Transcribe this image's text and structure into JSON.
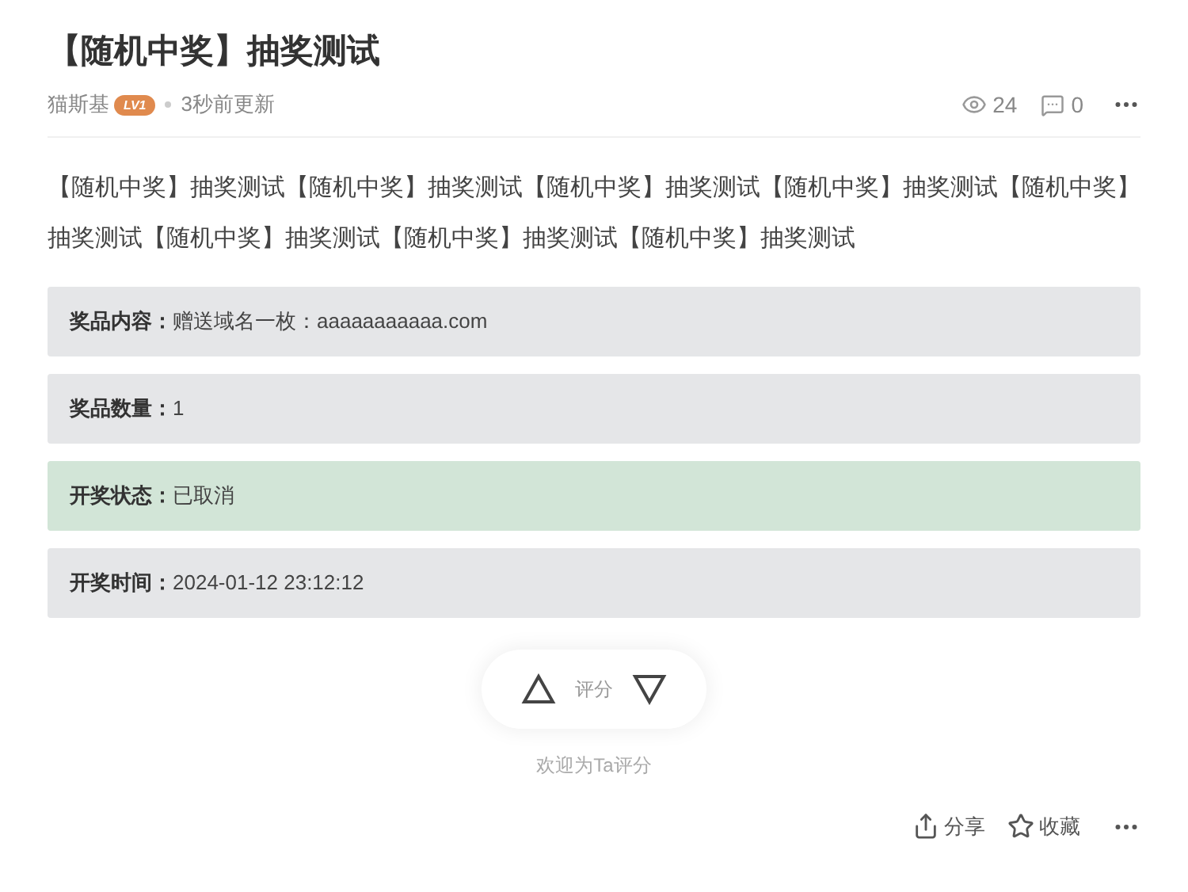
{
  "title": "【随机中奖】抽奖测试",
  "meta": {
    "author": "猫斯基",
    "level_badge": "LV1",
    "updated": "3秒前更新",
    "views": "24",
    "comments": "0"
  },
  "body": "【随机中奖】抽奖测试【随机中奖】抽奖测试【随机中奖】抽奖测试【随机中奖】抽奖测试【随机中奖】抽奖测试【随机中奖】抽奖测试【随机中奖】抽奖测试【随机中奖】抽奖测试",
  "info_rows": [
    {
      "label": "奖品内容：",
      "value": "赠送域名一枚：aaaaaaaaaaa.com",
      "color": "#e5e6e8"
    },
    {
      "label": "奖品数量：",
      "value": "1",
      "color": "#e5e6e8"
    },
    {
      "label": "开奖状态：",
      "value": "已取消",
      "color": "#d2e5d7"
    },
    {
      "label": "开奖时间：",
      "value": "2024-01-12 23:12:12",
      "color": "#e5e6e8"
    }
  ],
  "rating": {
    "label": "评分",
    "caption": "欢迎为Ta评分"
  },
  "actions": [
    {
      "kind": "share",
      "label": "分享"
    },
    {
      "kind": "favorite",
      "label": "收藏"
    }
  ]
}
